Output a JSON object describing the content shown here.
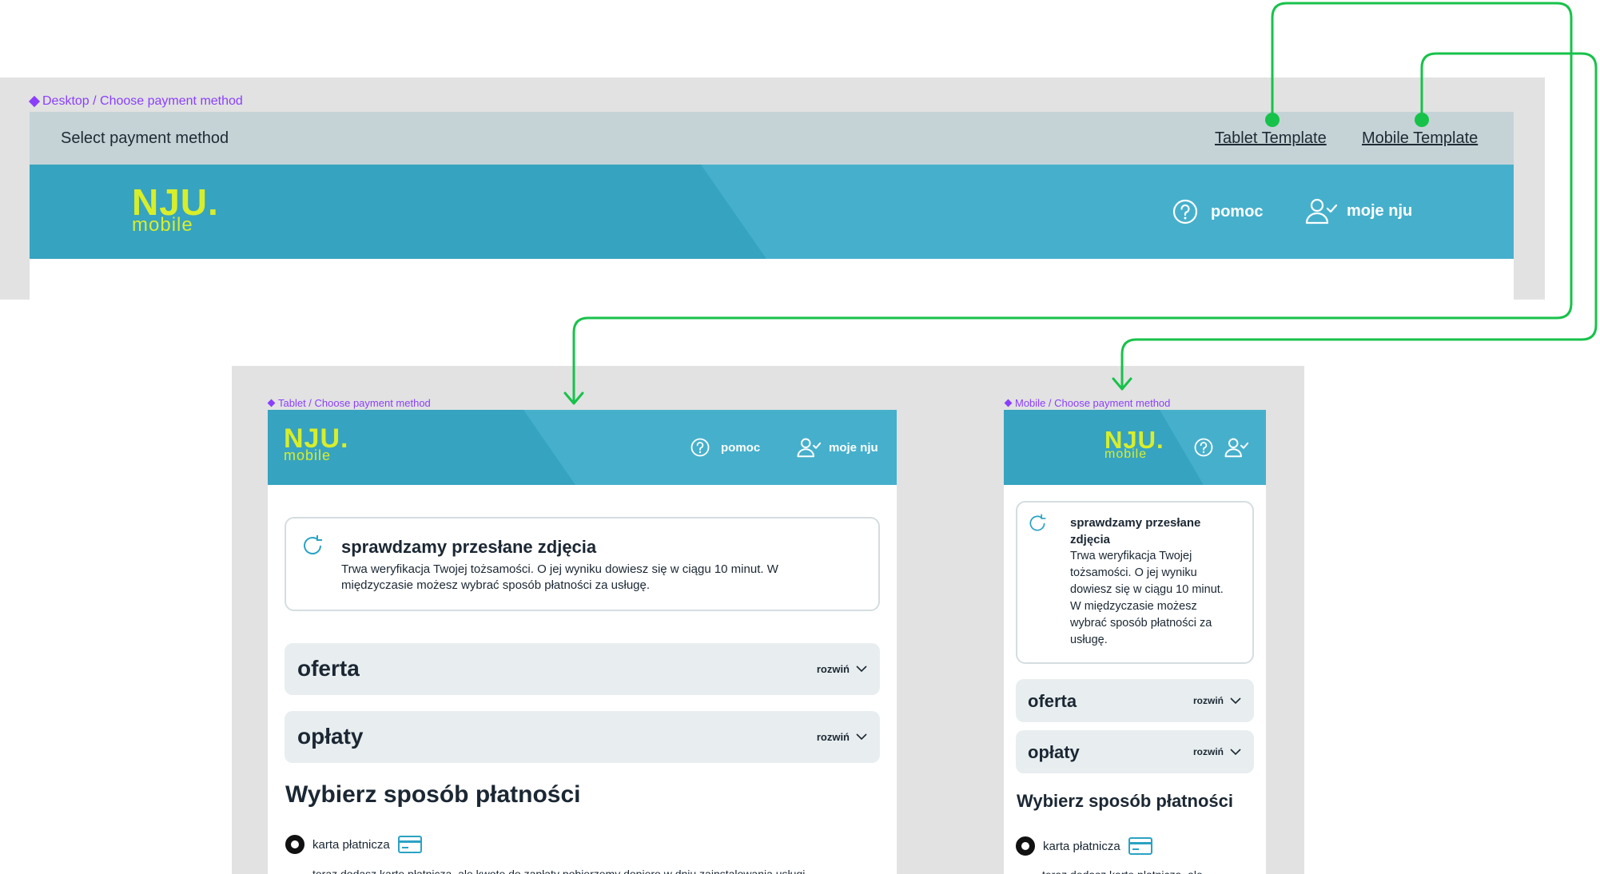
{
  "desktop": {
    "frame_label": "Desktop / Choose payment method",
    "toolbar_title": "Select payment method",
    "tablet_template_link": "Tablet Template",
    "mobile_template_link": "Mobile Template"
  },
  "tablet": {
    "frame_label": "Tablet / Choose payment method"
  },
  "mobile": {
    "frame_label": "Mobile / Choose payment method"
  },
  "header": {
    "logo_main": "NJU.",
    "logo_sub": "mobile",
    "help_label": "pomoc",
    "account_label": "moje nju"
  },
  "status": {
    "title": "sprawdzamy przesłane zdjęcia",
    "body_line1": "Trwa weryfikacja Twojej tożsamości. O jej wyniku dowiesz się w ciągu 10 minut. W",
    "body_line2": "międzyczasie możesz wybrać sposób płatności za usługę.",
    "mobile_title_line1": "sprawdzamy przesłane",
    "mobile_title_line2": "zdjęcia",
    "mobile_body": [
      "Trwa weryfikacja Twojej",
      "tożsamości. O jej wyniku",
      "dowiesz się w ciągu 10 minut.",
      "W międzyczasie możesz",
      "wybrać sposób płatności za",
      "usługę."
    ]
  },
  "accordions": {
    "offer_title": "oferta",
    "fees_title": "opłaty",
    "expand_label": "rozwiń"
  },
  "payment": {
    "section_title": "Wybierz sposób płatności",
    "card_option": "karta płatnicza",
    "card_desc": "teraz dodasz kartę płatniczą, ale kwotę do zapłaty pobierzemy dopiero w dniu zainstalowania usługi",
    "card_desc_mobile": "teraz dodasz kartę płatniczą, ale"
  },
  "colors": {
    "header_bg": "#46b0cc",
    "header_shade": "#36a3c0",
    "logo": "#d8ee2a",
    "connector": "#17c24a",
    "frame_label": "#8a3ffc",
    "toolbar_bg": "#c5d3d7",
    "accordion_bg": "#e8eeef",
    "card_icon": "#2aa3c4"
  }
}
